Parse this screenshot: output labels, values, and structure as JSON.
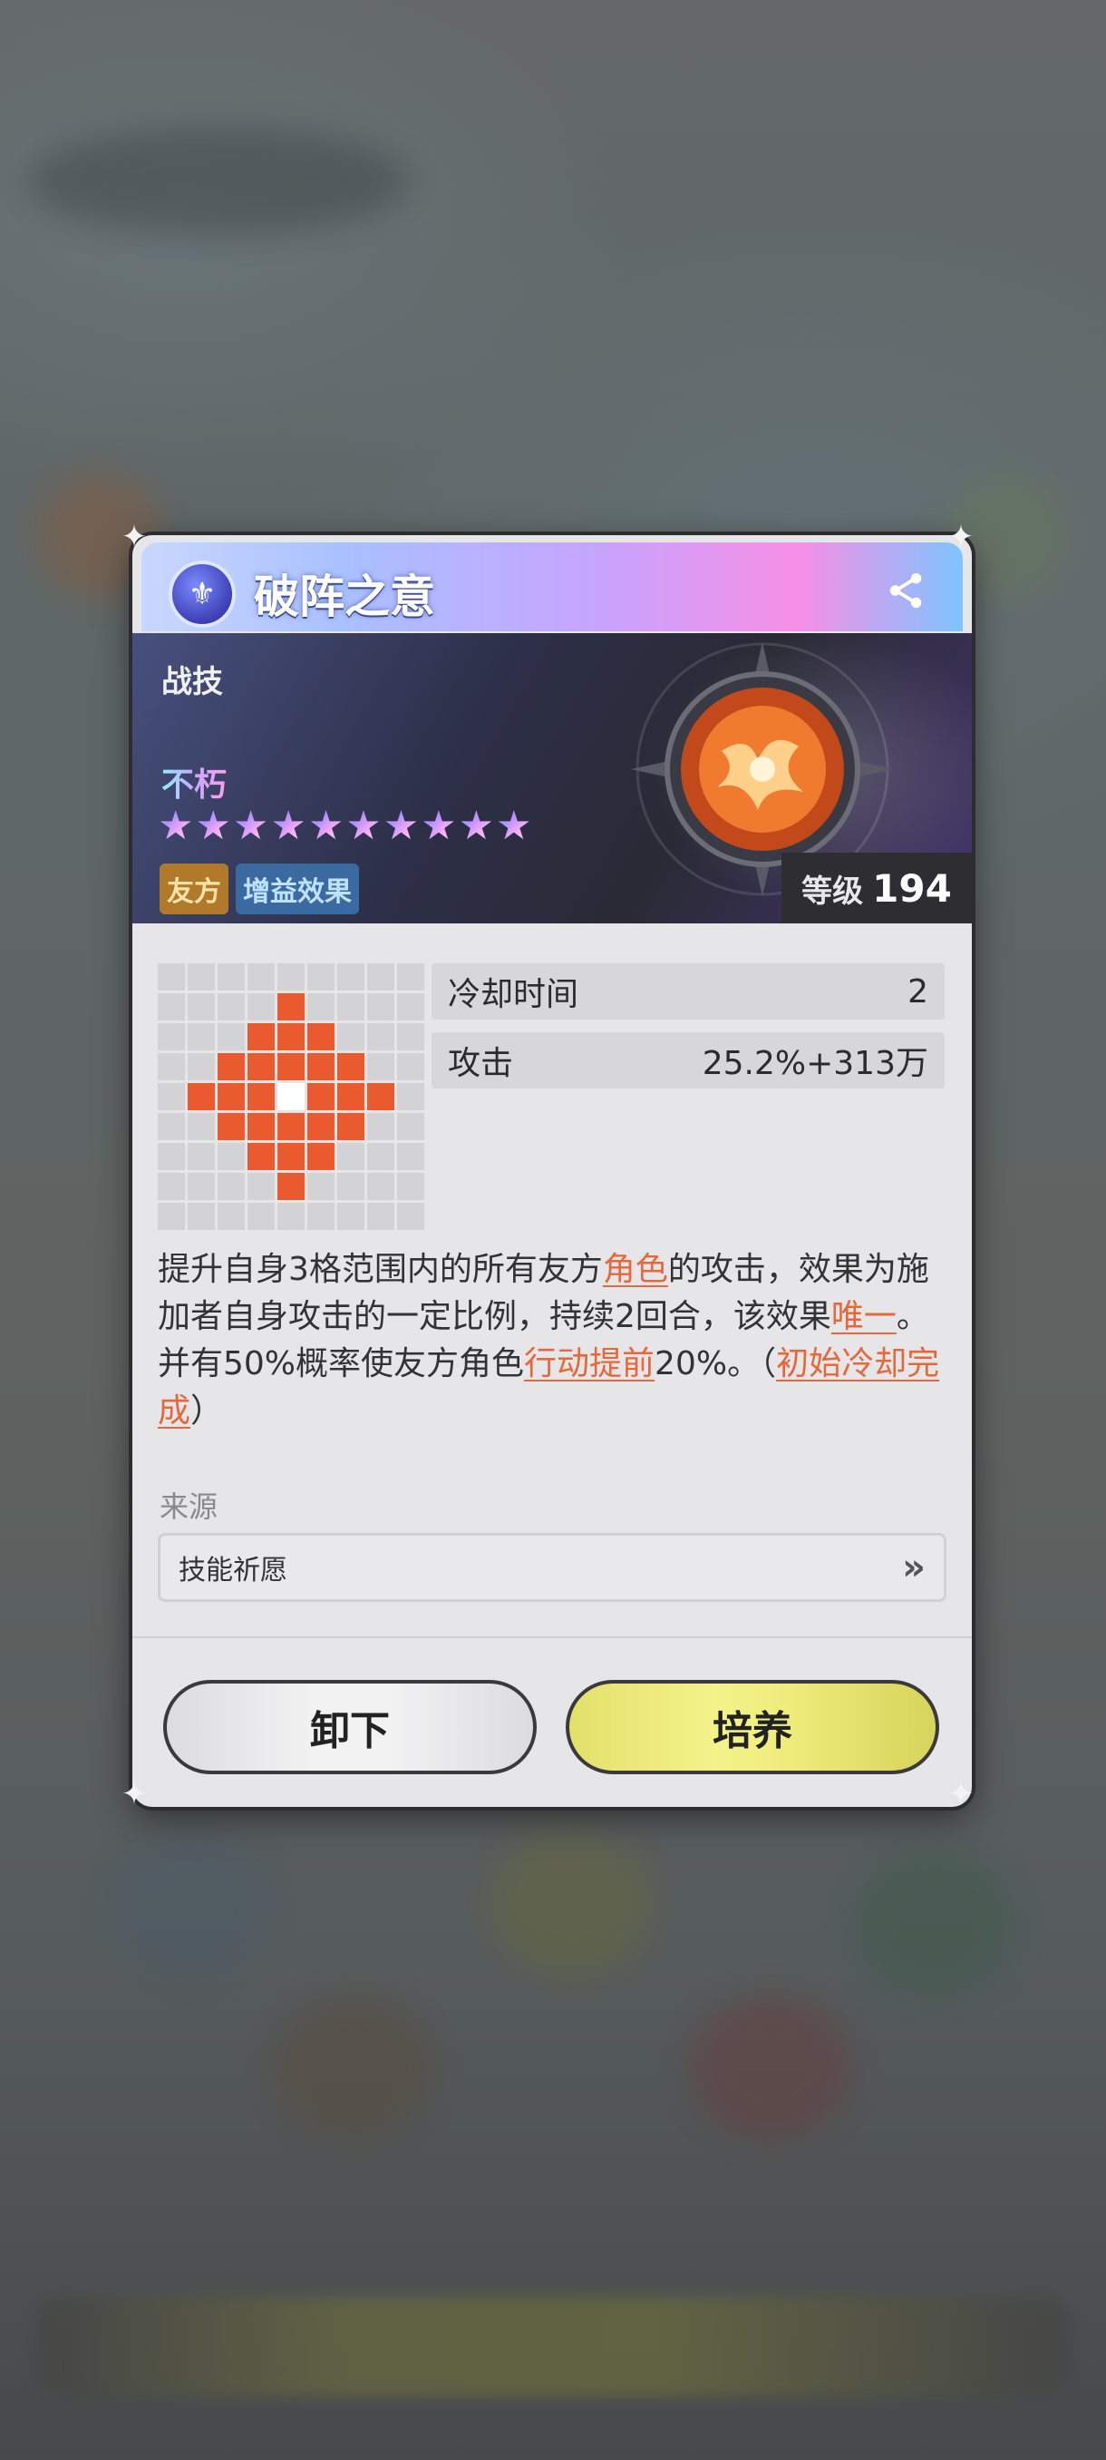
{
  "skill": {
    "name": "破阵之意",
    "type": "战技",
    "rarity": "不朽",
    "stars": 10,
    "tags": [
      "友方",
      "增益效果"
    ],
    "level_label": "等级",
    "level": "194"
  },
  "stats": [
    {
      "label": "冷却时间",
      "value": "2"
    },
    {
      "label": "攻击",
      "value": "25.2%+313万"
    }
  ],
  "description": {
    "p1": "提升自身3格范围内的所有友方",
    "h1": "角色",
    "p2": "的攻击，效果为施加者自身攻击的一定比例，持续2回合，该效果",
    "h2": "唯一",
    "p3": "。并有50%概率使友方角色",
    "h3": "行动提前",
    "p4": "20%。（",
    "h4": "初始冷却完成",
    "p5": "）"
  },
  "source": {
    "label": "来源",
    "item": "技能祈愿"
  },
  "buttons": {
    "unequip": "卸下",
    "train": "培养"
  },
  "icons": {
    "title": "skill-emblem-icon",
    "share": "share-icon",
    "source_go": "double-chevron-right-icon"
  },
  "range_grid": {
    "rows": [
      "000000000",
      "000010000",
      "000111000",
      "001111100",
      "011121110",
      "001111100",
      "000111000",
      "000010000",
      "000000000"
    ]
  },
  "colors": {
    "highlight": "#e5683a",
    "range_cell": "#ea5a2f",
    "train_button": "#eeec7a"
  }
}
